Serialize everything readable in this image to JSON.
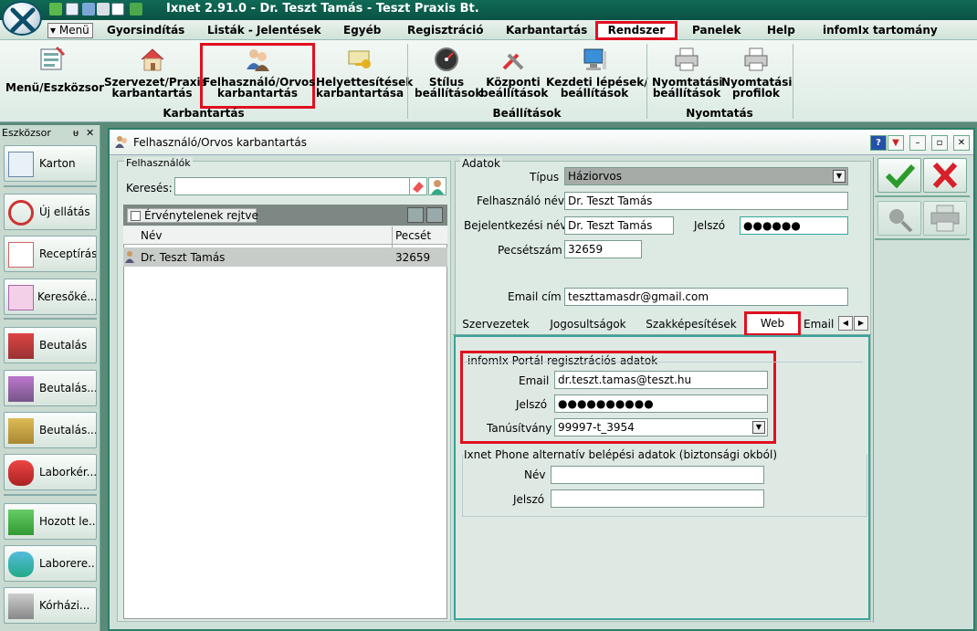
{
  "app": {
    "title": "Ixnet 2.91.0 - Dr. Teszt Tamás - Teszt Praxis Bt."
  },
  "menubar": {
    "menu_button": "Menü",
    "items": [
      "Gyorsindítás",
      "Listák - Jelentések",
      "Egyéb",
      "Regisztráció",
      "Karbantartás",
      "Rendszer",
      "Panelek",
      "Help",
      "infomIx tartomány"
    ]
  },
  "ribbon": {
    "buttons": {
      "menu_eszkozsor": "Menü/Eszközsor",
      "szervezet_1": "Szervezet/Praxis",
      "szervezet_2": "karbantartás",
      "felhasznalo_1": "Felhasználó/Orvos",
      "felhasznalo_2": "karbantartás",
      "helyettes_1": "Helyettesítések",
      "helyettes_2": "karbantartása",
      "stilus_1": "Stílus",
      "stilus_2": "beállítások",
      "kozponti_1": "Központi",
      "kozponti_2": "beállítások",
      "kezdeti_1": "Kezdeti lépések/",
      "kezdeti_2": "beállítások",
      "nyomtatasi_1": "Nyomtatási",
      "nyomtatasi_2": "beállítások",
      "profilok_1": "Nyomtatási",
      "profilok_2": "profilok"
    },
    "groups": {
      "karbantartas": "Karbantartás",
      "beallitasok": "Beállítások",
      "nyomtatas": "Nyomtatás"
    }
  },
  "toolbox": {
    "title": "Eszközsor",
    "pin": "ᵾ",
    "close": "✕",
    "items": [
      "Karton",
      "Új ellátás",
      "Receptírás",
      "Keresőké...",
      "Beutalás",
      "Beutalás...",
      "Beutalás...",
      "Laborkér...",
      "Hozott le...",
      "Laborere...",
      "Kórházi..."
    ]
  },
  "window": {
    "title": "Felhasználó/Orvos karbantartás",
    "left": {
      "section": "Felhasználók",
      "search_label": "Keresés:",
      "search_value": "",
      "hide_invalid": "Érvénytelenek rejtve",
      "columns": [
        "Név",
        "Pecsét"
      ],
      "rows": [
        {
          "name": "Dr. Teszt Tamás",
          "pecset": "32659"
        }
      ]
    },
    "right": {
      "section": "Adatok",
      "tipus_label": "Típus",
      "tipus_value": "Háziorvos",
      "felhnev_label": "Felhasználó név",
      "felhnev_value": "Dr. Teszt Tamás",
      "bejnev_label": "Bejelentkezési név",
      "bejnev_value": "Dr. Teszt Tamás",
      "jelszo_label": "Jelszó",
      "jelszo_value": "●●●●●●",
      "pecset_label": "Pecsétszám",
      "pecset_value": "32659",
      "email_label": "Email cím",
      "email_value": "teszttamasdr@gmail.com",
      "tabs": [
        "Szervezetek",
        "Jogosultságok",
        "Szakképesítések",
        "Web",
        "Email"
      ],
      "portal": {
        "title": "infomIx Portál regisztrációs adatok",
        "email_label": "Email",
        "email_value": "dr.teszt.tamas@teszt.hu",
        "jelszo_label": "Jelszó",
        "jelszo_value": "●●●●●●●●●●",
        "cert_label": "Tanúsítvány",
        "cert_value": "99997-t_3954"
      },
      "phone": {
        "title": "Ixnet Phone alternatív belépési adatok (biztonsági okból)",
        "nev_label": "Név",
        "nev_value": "",
        "jelszo_label": "Jelszó",
        "jelszo_value": ""
      }
    }
  },
  "colors": {
    "accent": "#0f6a55",
    "highlight_red": "#e01020",
    "selected_row": "#c8ccc9"
  }
}
